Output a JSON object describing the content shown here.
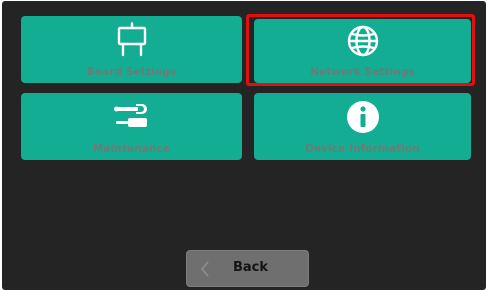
{
  "tiles": {
    "board_settings": {
      "label": "Board Settings",
      "icon": "whiteboard-icon"
    },
    "network_settings": {
      "label": "Network Settings",
      "icon": "globe-icon",
      "highlighted": true
    },
    "maintenance": {
      "label": "Maintenance",
      "icon": "tools-icon"
    },
    "device_information": {
      "label": "Device Information",
      "icon": "info-icon"
    }
  },
  "footer": {
    "back_label": "Back",
    "back_icon": "chevron-left-icon"
  },
  "colors": {
    "tile": "#13ad93",
    "background": "#242424",
    "highlight": "#e01010",
    "button": "#6f6f6f"
  }
}
